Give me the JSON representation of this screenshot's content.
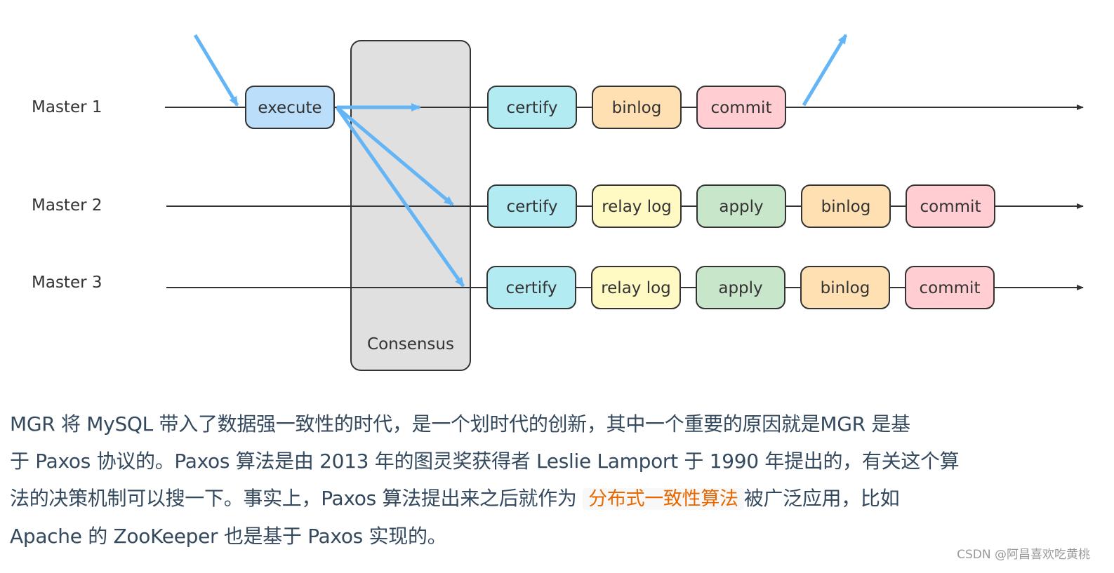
{
  "diagram": {
    "masters": [
      "Master 1",
      "Master 2",
      "Master 3"
    ],
    "consensus_label": "Consensus",
    "execute_label": "execute",
    "rows": [
      [
        "certify",
        "binlog",
        "commit"
      ],
      [
        "certify",
        "relay log",
        "apply",
        "binlog",
        "commit"
      ],
      [
        "certify",
        "relay log",
        "apply",
        "binlog",
        "commit"
      ]
    ],
    "colors": {
      "execute": "#bbdefb",
      "certify": "#b2ebf2",
      "binlog": "#ffe0b2",
      "commit": "#ffcdd2",
      "relay log": "#fff9c4",
      "apply": "#c8e6c9",
      "arrow": "#64b5f6",
      "consensus": "#e0e0e0"
    }
  },
  "article": {
    "line1": "MGR 将 MySQL 带入了数据强一致性的时代，是一个划时代的创新，其中一个重要的原因就是MGR 是基",
    "line2": "于 Paxos 协议的。Paxos 算法是由 2013 年的图灵奖获得者 Leslie Lamport 于 1990 年提出的，有关这个算",
    "line3_before": "法的决策机制可以搜一下。事实上，Paxos 算法提出来之后就作为 ",
    "line3_code": "分布式一致性算法",
    "line3_after": "被广泛应用，比如",
    "line4": "Apache 的 ZooKeeper 也是基于 Paxos 实现的。"
  },
  "watermark": "CSDN @阿昌喜欢吃黄桃"
}
